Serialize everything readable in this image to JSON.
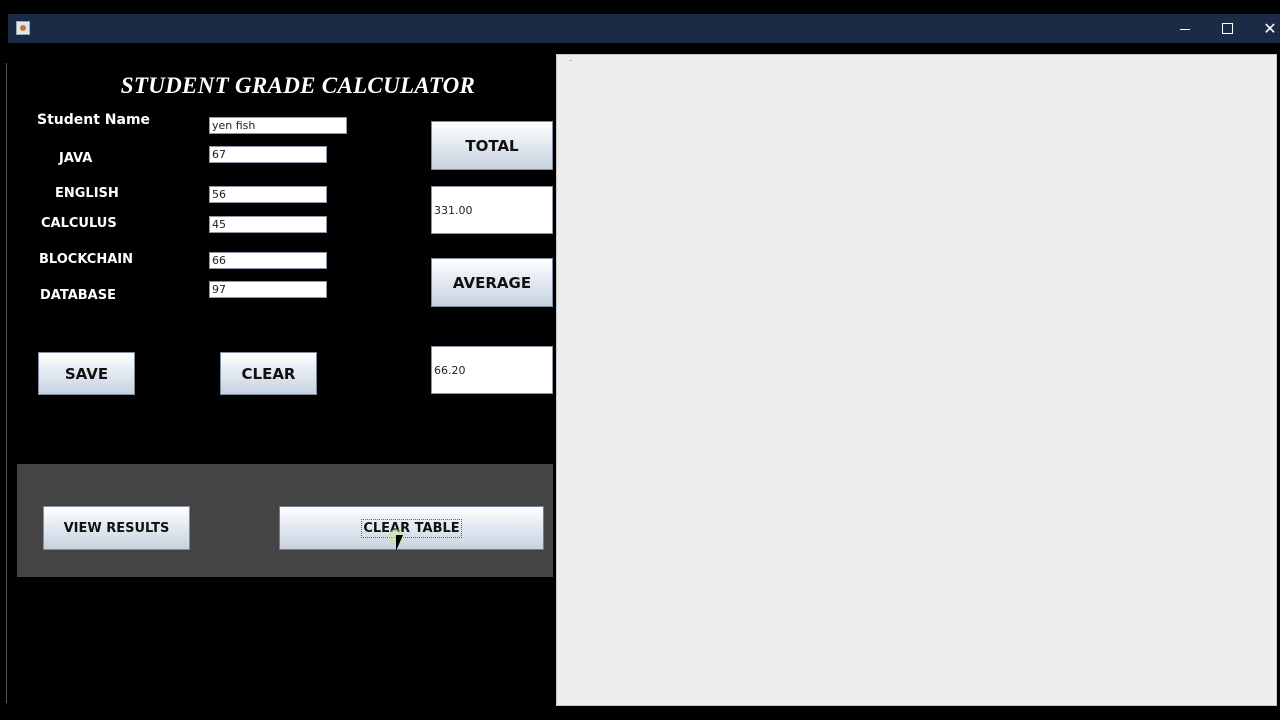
{
  "window": {
    "icon": "java-cup-icon",
    "controls": {
      "minimize": "minimize-icon",
      "maximize": "maximize-icon",
      "close": "close-icon"
    }
  },
  "form": {
    "title": "STUDENT GRADE CALCULATOR",
    "fields": {
      "student_name": {
        "label": "Student Name",
        "value": "yen fish"
      },
      "java": {
        "label": "JAVA",
        "value": "67"
      },
      "english": {
        "label": "ENGLISH",
        "value": "56"
      },
      "calculus": {
        "label": "CALCULUS",
        "value": "45"
      },
      "blockchain": {
        "label": "BLOCKCHAIN",
        "value": "66"
      },
      "database": {
        "label": "DATABASE",
        "value": "97"
      }
    },
    "buttons": {
      "save": "SAVE",
      "clear": "CLEAR",
      "total": "TOTAL",
      "average": "AVERAGE"
    },
    "outputs": {
      "total": "331.00",
      "average": "66.20"
    }
  },
  "bottom_panel": {
    "view_results": "VIEW RESULTS",
    "clear_table": "CLEAR TABLE"
  },
  "results_table": {
    "rows": []
  },
  "colors": {
    "background": "#000000",
    "titlebar": "#1b2a45",
    "panel": "#444444",
    "results_bg": "#ededed"
  }
}
